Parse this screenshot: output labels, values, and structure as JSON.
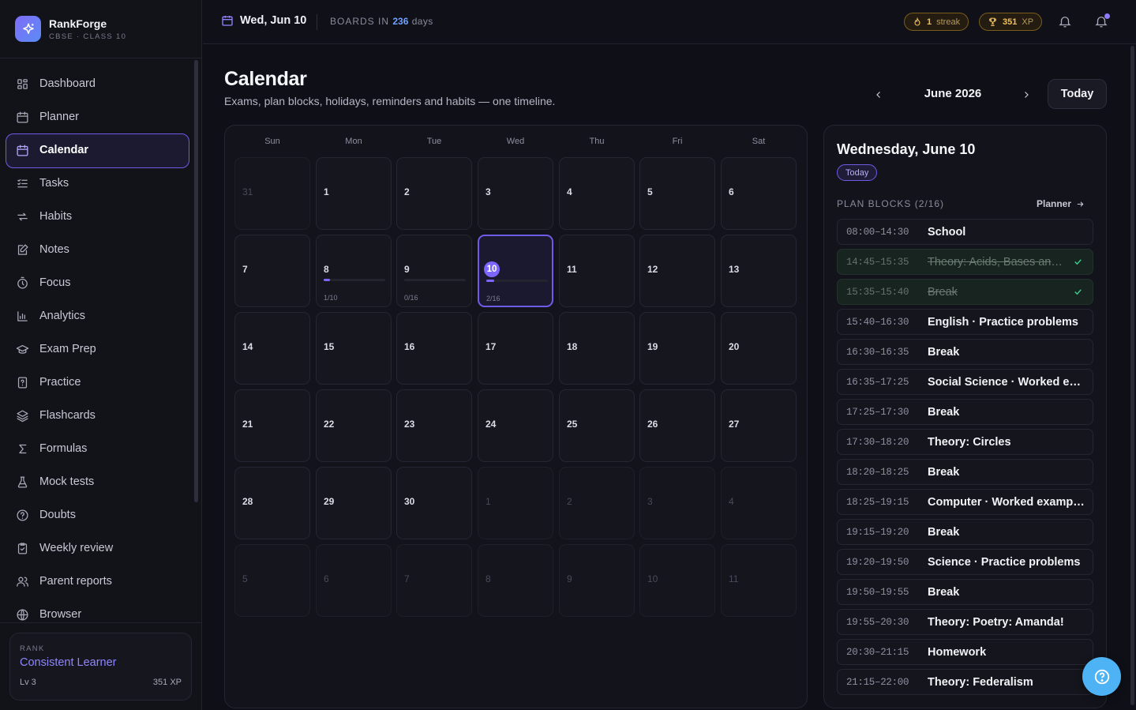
{
  "brand": {
    "name": "RankForge",
    "subtitle": "CBSE · CLASS 10"
  },
  "sidebar": {
    "items": [
      {
        "label": "Dashboard",
        "icon": "grid-icon"
      },
      {
        "label": "Planner",
        "icon": "calendar-icon"
      },
      {
        "label": "Calendar",
        "icon": "calendar-icon",
        "active": true
      },
      {
        "label": "Tasks",
        "icon": "list-check-icon"
      },
      {
        "label": "Habits",
        "icon": "repeat-icon"
      },
      {
        "label": "Notes",
        "icon": "note-edit-icon"
      },
      {
        "label": "Focus",
        "icon": "timer-icon"
      },
      {
        "label": "Analytics",
        "icon": "bar-chart-icon"
      },
      {
        "label": "Exam Prep",
        "icon": "graduation-cap-icon"
      },
      {
        "label": "Practice",
        "icon": "question-file-icon"
      },
      {
        "label": "Flashcards",
        "icon": "layers-icon"
      },
      {
        "label": "Formulas",
        "icon": "sigma-icon"
      },
      {
        "label": "Mock tests",
        "icon": "flask-icon"
      },
      {
        "label": "Doubts",
        "icon": "help-circle-icon"
      },
      {
        "label": "Weekly review",
        "icon": "clipboard-check-icon"
      },
      {
        "label": "Parent reports",
        "icon": "users-icon"
      },
      {
        "label": "Browser",
        "icon": "globe-icon"
      }
    ]
  },
  "rank": {
    "label": "RANK",
    "title": "Consistent Learner",
    "level": "Lv 3",
    "xp": "351 XP"
  },
  "topbar": {
    "date": "Wed, Jun 10",
    "boards_prefix": "BOARDS IN",
    "boards_days": "236",
    "boards_suffix": "days",
    "streak": {
      "num": "1",
      "unit": "streak"
    },
    "xp": {
      "num": "351",
      "unit": "XP"
    }
  },
  "page": {
    "title": "Calendar",
    "subtitle": "Exams, plan blocks, holidays, reminders and habits — one timeline."
  },
  "month_nav": {
    "month": "June 2026",
    "today_label": "Today"
  },
  "calendar": {
    "weekdays": [
      "Sun",
      "Mon",
      "Tue",
      "Wed",
      "Thu",
      "Fri",
      "Sat"
    ],
    "weeks": [
      [
        {
          "d": "31",
          "out": true
        },
        {
          "d": "1"
        },
        {
          "d": "2"
        },
        {
          "d": "3"
        },
        {
          "d": "4"
        },
        {
          "d": "5"
        },
        {
          "d": "6"
        }
      ],
      [
        {
          "d": "7"
        },
        {
          "d": "8",
          "progress": "1/10",
          "fraction": 0.1
        },
        {
          "d": "9",
          "progress": "0/16",
          "fraction": 0
        },
        {
          "d": "10",
          "progress": "2/16",
          "fraction": 0.125,
          "selected": true
        },
        {
          "d": "11"
        },
        {
          "d": "12"
        },
        {
          "d": "13"
        }
      ],
      [
        {
          "d": "14"
        },
        {
          "d": "15"
        },
        {
          "d": "16"
        },
        {
          "d": "17"
        },
        {
          "d": "18"
        },
        {
          "d": "19"
        },
        {
          "d": "20"
        }
      ],
      [
        {
          "d": "21"
        },
        {
          "d": "22"
        },
        {
          "d": "23"
        },
        {
          "d": "24"
        },
        {
          "d": "25"
        },
        {
          "d": "26"
        },
        {
          "d": "27"
        }
      ],
      [
        {
          "d": "28"
        },
        {
          "d": "29"
        },
        {
          "d": "30"
        },
        {
          "d": "1",
          "out": true
        },
        {
          "d": "2",
          "out": true
        },
        {
          "d": "3",
          "out": true
        },
        {
          "d": "4",
          "out": true
        }
      ],
      [
        {
          "d": "5",
          "out": true
        },
        {
          "d": "6",
          "out": true
        },
        {
          "d": "7",
          "out": true
        },
        {
          "d": "8",
          "out": true
        },
        {
          "d": "9",
          "out": true
        },
        {
          "d": "10",
          "out": true
        },
        {
          "d": "11",
          "out": true
        }
      ]
    ]
  },
  "day_panel": {
    "title": "Wednesday, June 10",
    "badge": "Today",
    "section_label": "PLAN BLOCKS (2/16)",
    "planner_link": "Planner",
    "blocks": [
      {
        "time": "08:00–14:30",
        "title": "School"
      },
      {
        "time": "14:45–15:35",
        "title": "Theory: Acids, Bases and Salts",
        "done": true
      },
      {
        "time": "15:35–15:40",
        "title": "Break",
        "done": true
      },
      {
        "time": "15:40–16:30",
        "title": "English · Practice problems"
      },
      {
        "time": "16:30–16:35",
        "title": "Break"
      },
      {
        "time": "16:35–17:25",
        "title": "Social Science · Worked examples"
      },
      {
        "time": "17:25–17:30",
        "title": "Break"
      },
      {
        "time": "17:30–18:20",
        "title": "Theory: Circles"
      },
      {
        "time": "18:20–18:25",
        "title": "Break"
      },
      {
        "time": "18:25–19:15",
        "title": "Computer · Worked examples"
      },
      {
        "time": "19:15–19:20",
        "title": "Break"
      },
      {
        "time": "19:20–19:50",
        "title": "Science · Practice problems"
      },
      {
        "time": "19:50–19:55",
        "title": "Break"
      },
      {
        "time": "19:55–20:30",
        "title": "Theory: Poetry: Amanda!"
      },
      {
        "time": "20:30–21:15",
        "title": "Homework"
      },
      {
        "time": "21:15–22:00",
        "title": "Theory: Federalism"
      }
    ]
  },
  "colors": {
    "accent": "#7b67ff",
    "gold": "#f2c057",
    "done": "#3ccf8e",
    "help": "#4db3f5"
  }
}
